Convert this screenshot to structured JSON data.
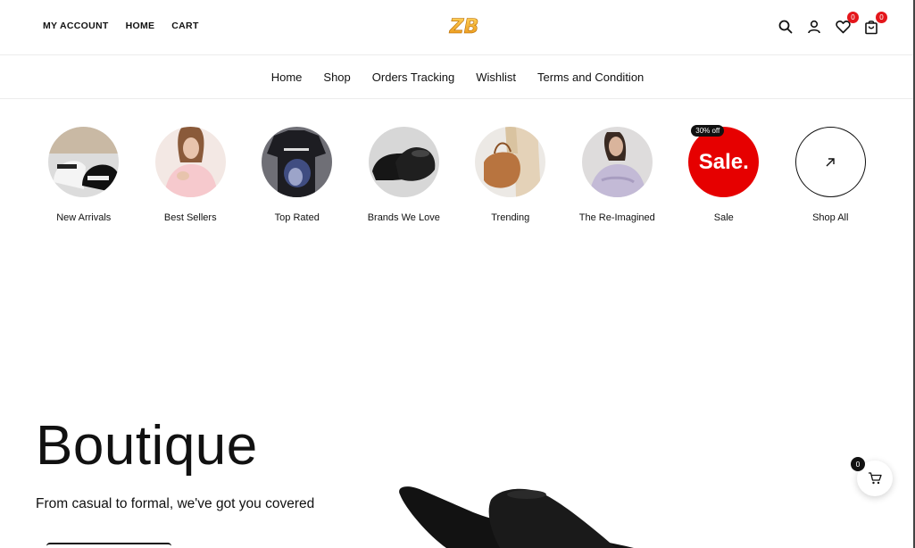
{
  "header": {
    "top_links": [
      "MY ACCOUNT",
      "HOME",
      "CART"
    ],
    "logo_text": "ZB",
    "icons": [
      "search-icon",
      "user-icon",
      "heart-icon",
      "bag-icon"
    ],
    "wishlist_count": "0",
    "cart_count": "0"
  },
  "nav": {
    "items": [
      "Home",
      "Shop",
      "Orders Tracking",
      "Wishlist",
      "Terms and Condition"
    ]
  },
  "categories": [
    {
      "label": "New Arrivals"
    },
    {
      "label": "Best Sellers"
    },
    {
      "label": "Top Rated"
    },
    {
      "label": "Brands We Love"
    },
    {
      "label": "Trending"
    },
    {
      "label": "The Re-Imagined"
    },
    {
      "label": "Sale",
      "circle_text": "Sale.",
      "tag": "30% off"
    },
    {
      "label": "Shop All"
    }
  ],
  "hero": {
    "title": "Boutique",
    "subtitle": "From casual to formal, we've got you covered"
  },
  "floating_cart": {
    "count": "0"
  },
  "colors": {
    "accent": "#e60000",
    "logo": "#f2a81d",
    "badge": "#e4161b"
  }
}
